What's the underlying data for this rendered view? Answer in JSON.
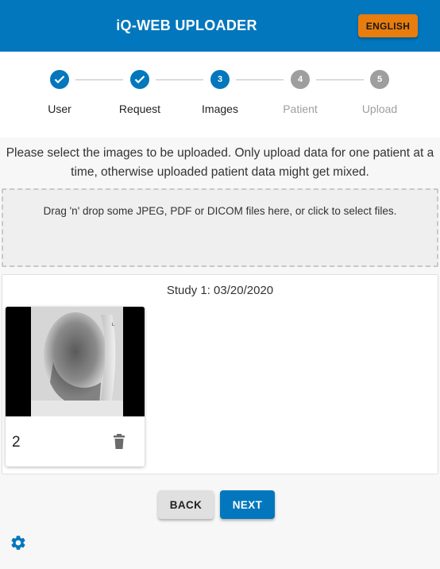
{
  "header": {
    "title": "iQ-WEB UPLOADER",
    "language_button": "ENGLISH"
  },
  "stepper": {
    "steps": [
      {
        "label": "User",
        "number": "1",
        "state": "completed"
      },
      {
        "label": "Request",
        "number": "2",
        "state": "completed"
      },
      {
        "label": "Images",
        "number": "3",
        "state": "active"
      },
      {
        "label": "Patient",
        "number": "4",
        "state": "inactive"
      },
      {
        "label": "Upload",
        "number": "5",
        "state": "inactive"
      }
    ]
  },
  "instructions": "Please select the images to be uploaded. Only upload data for one patient at a time, otherwise uploaded patient data might get mixed.",
  "dropzone": {
    "text": "Drag 'n' drop some JPEG, PDF or DICOM files here, or click to select files."
  },
  "study": {
    "title": "Study 1: 03/20/2020",
    "images": [
      {
        "count": "2",
        "icon": "delete-icon"
      }
    ]
  },
  "footer": {
    "back_label": "BACK",
    "next_label": "NEXT",
    "settings_icon": "gear-icon"
  },
  "colors": {
    "primary": "#0277bd",
    "accent": "#e87d0d",
    "inactive": "#9e9e9e"
  }
}
